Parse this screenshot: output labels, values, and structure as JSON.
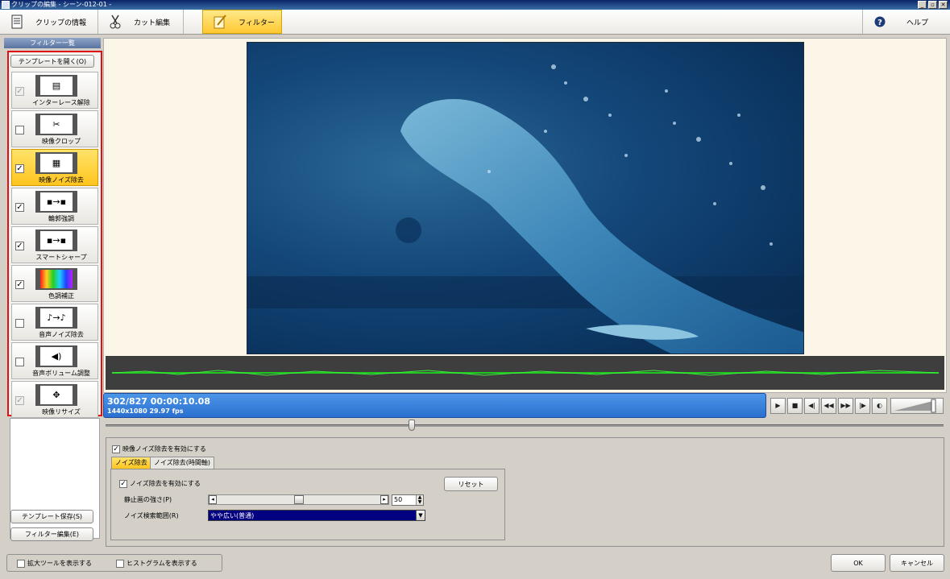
{
  "window": {
    "title": "クリップの編集 - シーン-012-01 -",
    "buttons": [
      "_",
      "▫",
      "✕"
    ]
  },
  "toolbar": {
    "clip_info": "クリップの情報",
    "cut_edit": "カット編集",
    "filter": "フィルター",
    "help": "ヘルプ"
  },
  "left_panel": {
    "header": "フィルター一覧",
    "open_template": "テンプレートを開く(O)",
    "save_template": "テンプレート保存(S)",
    "edit_filter": "フィルター編集(E)",
    "filters": [
      {
        "label": "インターレース解除",
        "checked": true,
        "disabled": true,
        "selected": false,
        "icon": "deinterlace-icon"
      },
      {
        "label": "映像クロップ",
        "checked": false,
        "disabled": false,
        "selected": false,
        "icon": "crop-icon"
      },
      {
        "label": "映像ノイズ除去",
        "checked": true,
        "disabled": false,
        "selected": true,
        "icon": "noise-reduction-icon"
      },
      {
        "label": "輪郭強調",
        "checked": true,
        "disabled": false,
        "selected": false,
        "icon": "edge-enhance-icon"
      },
      {
        "label": "スマートシャープ",
        "checked": true,
        "disabled": false,
        "selected": false,
        "icon": "smart-sharpen-icon"
      },
      {
        "label": "色調補正",
        "checked": true,
        "disabled": false,
        "selected": false,
        "icon": "color-correction-icon"
      },
      {
        "label": "音声ノイズ除去",
        "checked": false,
        "disabled": false,
        "selected": false,
        "icon": "audio-noise-icon"
      },
      {
        "label": "音声ボリューム調整",
        "checked": false,
        "disabled": false,
        "selected": false,
        "icon": "volume-adjust-icon"
      },
      {
        "label": "映像リサイズ",
        "checked": true,
        "disabled": true,
        "selected": false,
        "icon": "resize-icon"
      }
    ]
  },
  "timecode": {
    "position": "302/827  00:00:10.08",
    "format": "1440x1080 29.97 fps"
  },
  "seek": {
    "progress": 0.365
  },
  "settings": {
    "enable_label": "映像ノイズ除去を有効にする",
    "enable_checked": true,
    "tabs": [
      "ノイズ除去",
      "ノイズ除去(時間軸)"
    ],
    "noise_enable_label": "ノイズ除去を有効にする",
    "reset": "リセット",
    "strength_label": "静止画の強さ(P)",
    "strength_value": "50",
    "strength_fraction": 0.5,
    "range_label": "ノイズ検索範囲(R)",
    "range_value": "やや広い(普通)"
  },
  "bottom": {
    "zoom_tool": "拡大ツールを表示する",
    "histogram": "ヒストグラムを表示する",
    "ok": "OK",
    "cancel": "キャンセル"
  }
}
